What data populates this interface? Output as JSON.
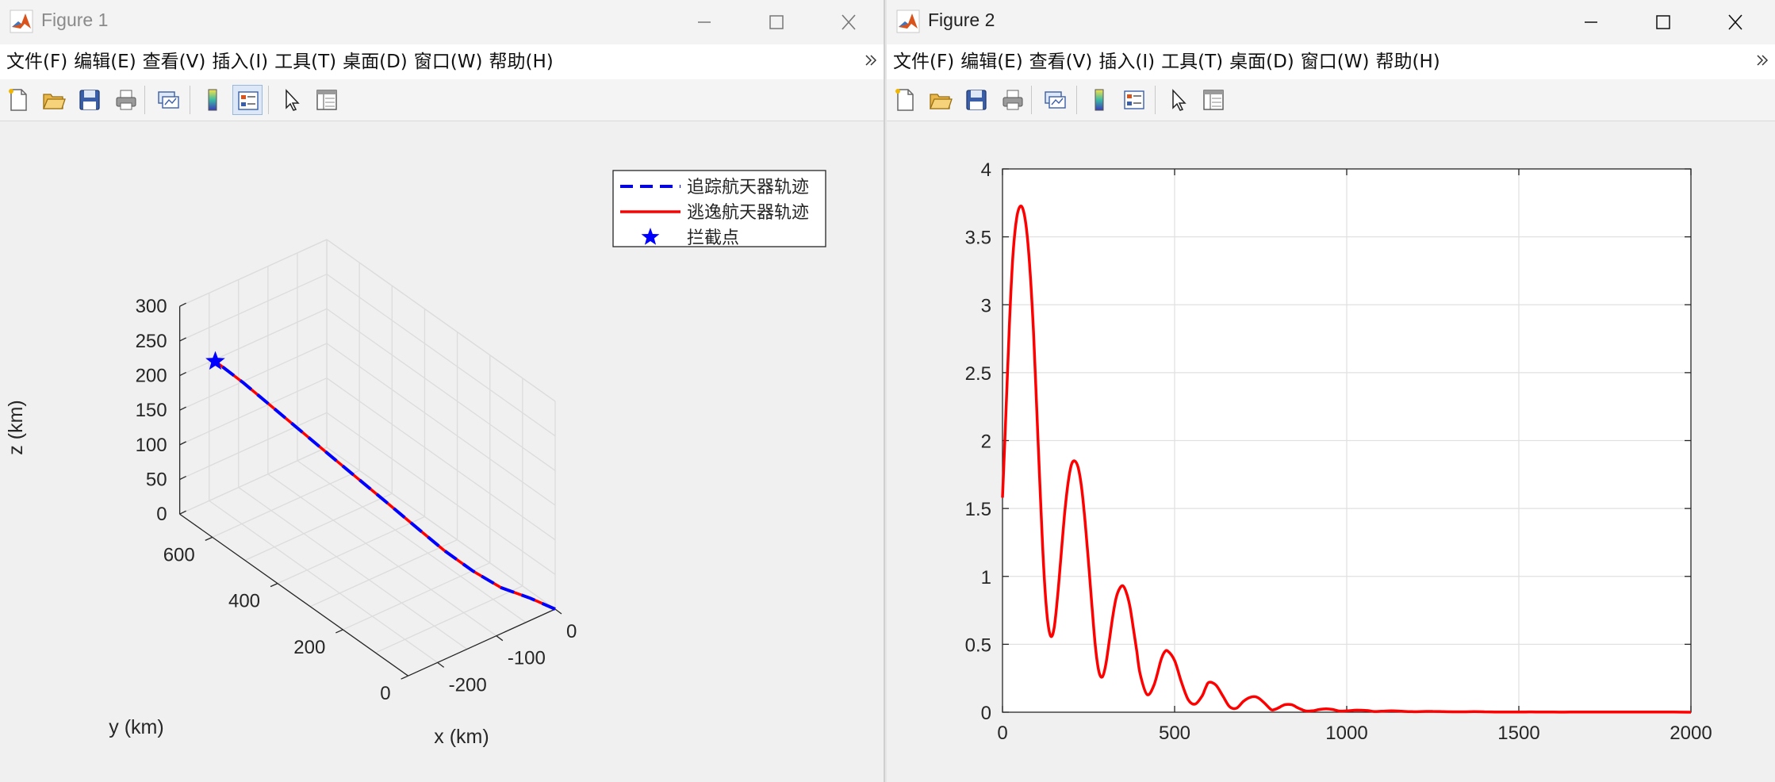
{
  "figure1": {
    "title": "Figure 1",
    "menu": [
      "文件(F)",
      "编辑(E)",
      "查看(V)",
      "插入(I)",
      "工具(T)",
      "桌面(D)",
      "窗口(W)",
      "帮助(H)"
    ],
    "overflow_icon": "chevron-double-icon",
    "toolbar_icons": [
      "new-figure-icon",
      "open-file-icon",
      "save-icon",
      "print-icon",
      "link-plot-icon",
      "insert-colorbar-icon",
      "insert-legend-icon",
      "edit-pointer-icon",
      "property-inspector-icon"
    ],
    "plot": {
      "zlabel": "z (km)",
      "xlabel": "x (km)",
      "ylabel": "y (km)",
      "zticks": [
        "0",
        "50",
        "100",
        "150",
        "200",
        "250",
        "300"
      ],
      "xticks": [
        "0",
        "-100",
        "-200"
      ],
      "yticks": [
        "0",
        "200",
        "400",
        "600"
      ],
      "legend": {
        "items": [
          {
            "label": "追踪航天器轨迹",
            "color": "#0000ff",
            "style": "dashed"
          },
          {
            "label": "逃逸航天器轨迹",
            "color": "#ff0000",
            "style": "solid"
          },
          {
            "label": "拦截点",
            "color": "#0000ff",
            "style": "star"
          }
        ]
      }
    }
  },
  "figure2": {
    "title": "Figure 2",
    "menu": [
      "文件(F)",
      "编辑(E)",
      "查看(V)",
      "插入(I)",
      "工具(T)",
      "桌面(D)",
      "窗口(W)",
      "帮助(H)"
    ],
    "overflow_icon": "chevron-double-icon",
    "toolbar_icons": [
      "new-figure-icon",
      "open-file-icon",
      "save-icon",
      "print-icon",
      "link-plot-icon",
      "insert-colorbar-icon",
      "insert-legend-icon",
      "edit-pointer-icon",
      "property-inspector-icon"
    ]
  },
  "chart_data": [
    {
      "type": "line",
      "dimensions": 3,
      "title": "",
      "xlabel": "x (km)",
      "ylabel": "y (km)",
      "zlabel": "z (km)",
      "xlim": [
        -250,
        0
      ],
      "ylim": [
        0,
        700
      ],
      "zlim": [
        0,
        300
      ],
      "grid": true,
      "legend_position": "top-right",
      "series": [
        {
          "name": "追踪航天器轨迹",
          "color": "#0000ff",
          "style": "dashed",
          "x": [
            0,
            -20,
            -45,
            -65,
            -85,
            -105,
            -125,
            -145,
            -165,
            -185,
            -205,
            -225,
            -245
          ],
          "y": [
            0,
            40,
            85,
            135,
            185,
            240,
            290,
            345,
            400,
            450,
            500,
            550,
            600
          ],
          "z": [
            0,
            10,
            20,
            35,
            55,
            80,
            105,
            130,
            155,
            180,
            205,
            230,
            252
          ]
        },
        {
          "name": "逃逸航天器轨迹",
          "color": "#ff0000",
          "style": "solid",
          "x": [
            0,
            -20,
            -45,
            -65,
            -85,
            -105,
            -125,
            -145,
            -165,
            -185,
            -205,
            -225,
            -245
          ],
          "y": [
            0,
            40,
            85,
            135,
            185,
            240,
            290,
            345,
            400,
            450,
            500,
            550,
            600
          ],
          "z": [
            0,
            10,
            20,
            35,
            55,
            80,
            105,
            130,
            155,
            180,
            205,
            230,
            252
          ]
        },
        {
          "name": "拦截点",
          "color": "#0000ff",
          "style": "star",
          "x": [
            -245
          ],
          "y": [
            600
          ],
          "z": [
            252
          ]
        }
      ]
    },
    {
      "type": "line",
      "title": "",
      "xlabel": "",
      "ylabel": "",
      "xlim": [
        0,
        2000
      ],
      "ylim": [
        0,
        4
      ],
      "xticks": [
        0,
        500,
        1000,
        1500,
        2000
      ],
      "yticks": [
        0,
        0.5,
        1,
        1.5,
        2,
        2.5,
        3,
        3.5,
        4
      ],
      "grid": true,
      "series": [
        {
          "color": "#ff0000",
          "x": [
            0,
            10,
            20,
            30,
            40,
            50,
            60,
            70,
            80,
            90,
            100,
            110,
            120,
            130,
            140,
            150,
            160,
            170,
            180,
            190,
            200,
            210,
            220,
            230,
            240,
            250,
            260,
            270,
            280,
            290,
            300,
            310,
            320,
            330,
            340,
            350,
            360,
            370,
            380,
            390,
            400,
            420,
            440,
            460,
            470,
            480,
            500,
            520,
            540,
            560,
            580,
            590,
            600,
            620,
            640,
            660,
            680,
            700,
            720,
            740,
            760,
            780,
            790,
            800,
            820,
            840,
            860,
            880,
            900,
            920,
            940,
            960,
            980,
            1000,
            1030,
            1060,
            1080,
            1100,
            1130,
            1160,
            1190,
            1220,
            1250,
            1280,
            1310,
            1340,
            1370,
            1400,
            1430,
            1460,
            1490,
            1520,
            1550,
            1600,
            1650,
            1700,
            1750,
            1800,
            1850,
            1900,
            1950,
            2000
          ],
          "y": [
            1.58,
            2.2,
            2.85,
            3.35,
            3.62,
            3.72,
            3.7,
            3.55,
            3.25,
            2.8,
            2.2,
            1.6,
            1.05,
            0.7,
            0.56,
            0.62,
            0.85,
            1.15,
            1.45,
            1.68,
            1.82,
            1.85,
            1.8,
            1.65,
            1.4,
            1.1,
            0.78,
            0.48,
            0.3,
            0.26,
            0.35,
            0.52,
            0.7,
            0.84,
            0.91,
            0.93,
            0.88,
            0.78,
            0.62,
            0.45,
            0.28,
            0.13,
            0.2,
            0.38,
            0.44,
            0.45,
            0.38,
            0.22,
            0.09,
            0.06,
            0.12,
            0.18,
            0.22,
            0.2,
            0.12,
            0.04,
            0.03,
            0.08,
            0.11,
            0.11,
            0.07,
            0.02,
            0.02,
            0.03,
            0.055,
            0.055,
            0.03,
            0.01,
            0.01,
            0.02,
            0.025,
            0.02,
            0.008,
            0.01,
            0.015,
            0.012,
            0.005,
            0.007,
            0.01,
            0.007,
            0.004,
            0.005,
            0.006,
            0.004,
            0.003,
            0.003,
            0.004,
            0.003,
            0.002,
            0.002,
            0.002,
            0.002,
            0.002,
            0.001,
            0.001,
            0.001,
            0.001,
            0.001,
            0.001,
            0.001,
            0.001,
            0.0
          ]
        }
      ]
    }
  ]
}
